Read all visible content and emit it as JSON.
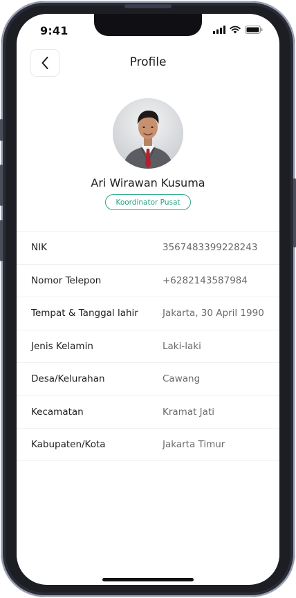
{
  "status_bar": {
    "time": "9:41",
    "signal_icon": "cellular-signal-icon",
    "wifi_icon": "wifi-icon",
    "battery_icon": "battery-icon"
  },
  "header": {
    "back_icon": "chevron-left-icon",
    "title": "Profile"
  },
  "profile": {
    "avatar": "profile-photo",
    "name": "Ari Wirawan Kusuma",
    "role": "Koordinator Pusat"
  },
  "details": [
    {
      "label": "NIK",
      "value": "3567483399228243"
    },
    {
      "label": "Nomor Telepon",
      "value": "+6282143587984"
    },
    {
      "label": "Tempat & Tanggal lahir",
      "value": "Jakarta, 30 April 1990"
    },
    {
      "label": "Jenis Kelamin",
      "value": "Laki-laki"
    },
    {
      "label": "Desa/Kelurahan",
      "value": "Cawang"
    },
    {
      "label": "Kecamatan",
      "value": "Kramat Jati"
    },
    {
      "label": "Kabupaten/Kota",
      "value": "Jakarta Timur"
    }
  ],
  "colors": {
    "accent": "#2fa98a",
    "text_primary": "#1e1e1e",
    "text_secondary": "#6a6a6a",
    "divider": "#eef0f2"
  }
}
